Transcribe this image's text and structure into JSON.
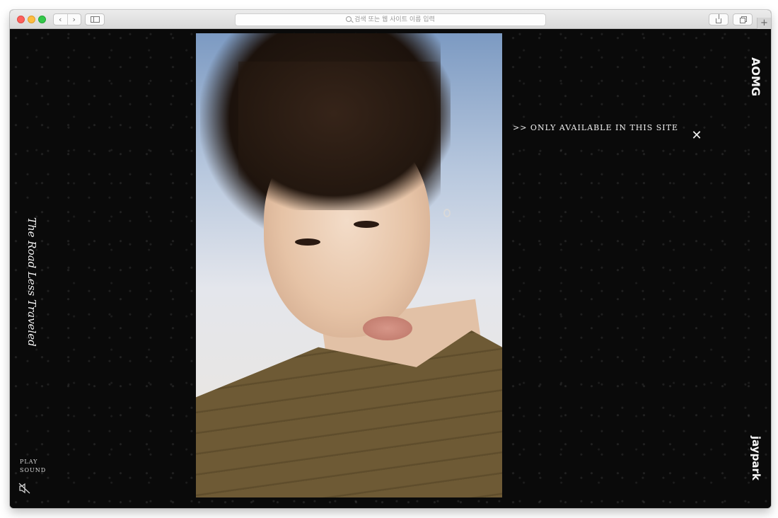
{
  "browser": {
    "address_placeholder": "검색 또는 웹 사이트 이름 입력",
    "new_tab_label": "+",
    "back_label": "‹",
    "forward_label": "›"
  },
  "page": {
    "side_title": "The Road Less Traveled",
    "notice": ">> ONLY AVAILABLE IN THIS SITE",
    "close_label": "✕",
    "top_logo": "AOMG",
    "bottom_logo": "jaypark",
    "sound_label_line1": "PLAY",
    "sound_label_line2": "SOUND"
  },
  "icons": {
    "search": "search-icon",
    "sidebar": "sidebar-icon",
    "share": "share-icon",
    "tabs": "tabs-icon",
    "close": "close-icon",
    "mute": "speaker-muted-icon"
  },
  "colors": {
    "background": "#0a0a0a",
    "text": "#f0f0f0",
    "shirt": "#6e5a35"
  }
}
